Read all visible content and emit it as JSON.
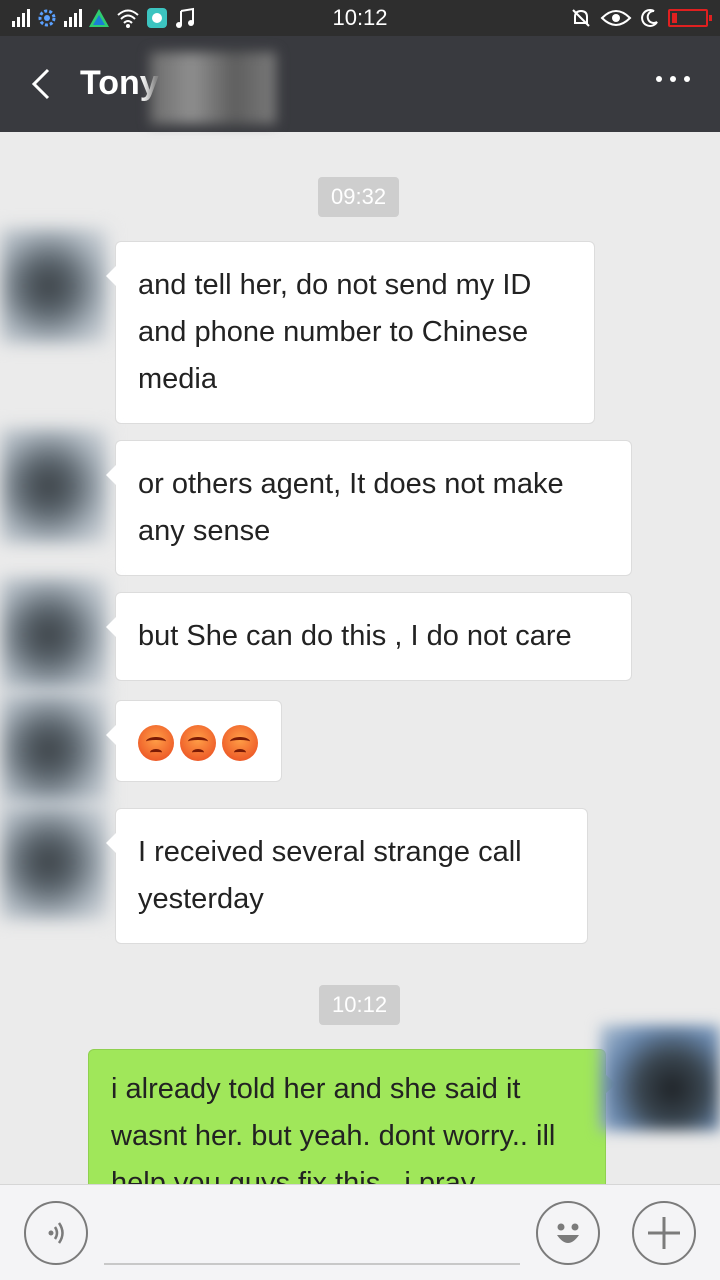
{
  "status_bar": {
    "time": "10:12",
    "icons": [
      "signal-icon",
      "settings-cog-icon",
      "signal-icon",
      "app-icon",
      "wifi-icon",
      "chat-app-icon",
      "music-note-icon",
      "mute-bell-icon",
      "eye-icon",
      "moon-icon",
      "battery-low-icon"
    ]
  },
  "header": {
    "title": "Tony",
    "back_icon": "chevron-left-icon",
    "more_icon": "more-dots-icon"
  },
  "chat": {
    "timestamps": [
      "09:32",
      "10:12"
    ],
    "incoming": [
      {
        "text": "and tell her, do not send my ID and phone number to Chinese media"
      },
      {
        "text": "or others agent, It does not make any sense"
      },
      {
        "text": "but She can do this , I do not care"
      },
      {
        "emojis": [
          "angry-face-emoji",
          "angry-face-emoji",
          "angry-face-emoji"
        ]
      },
      {
        "text": "I received several strange call yesterday"
      }
    ],
    "outgoing": [
      {
        "text": "i already told her and she said it wasnt her. but yeah. dont worry.. ill help you guys fix this.. i pray"
      }
    ]
  },
  "input_bar": {
    "voice_icon": "voice-icon",
    "emoji_icon": "smiley-icon",
    "plus_icon": "plus-icon"
  },
  "colors": {
    "status_bar_bg": "#2e2e2e",
    "header_bg": "#393a3f",
    "chat_bg": "#ebebeb",
    "my_bubble": "#a0e75a",
    "their_bubble": "#ffffff"
  }
}
